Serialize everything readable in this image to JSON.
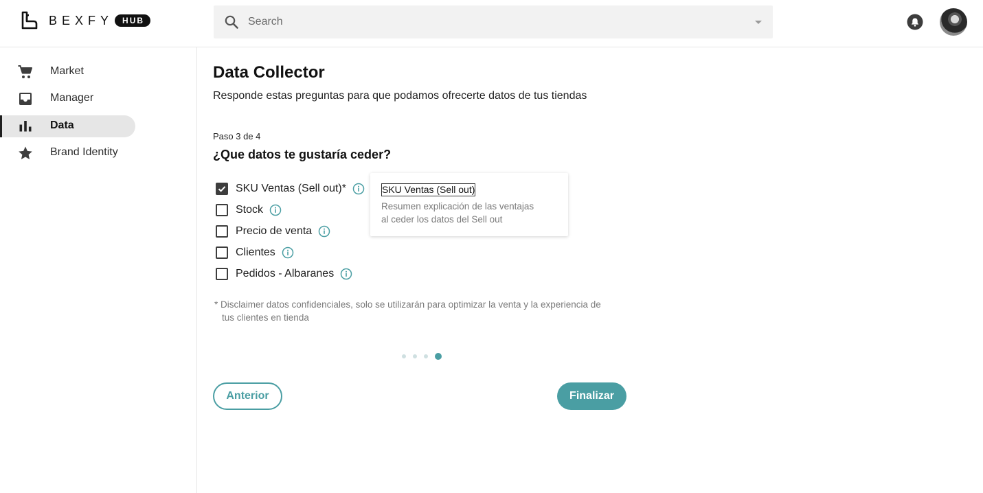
{
  "brand": {
    "name": "BEXFY",
    "badge": "HUB"
  },
  "search": {
    "placeholder": "Search"
  },
  "sidebar": {
    "items": [
      {
        "label": "Market",
        "icon": "cart-icon"
      },
      {
        "label": "Manager",
        "icon": "inbox-icon"
      },
      {
        "label": "Data",
        "icon": "bar-chart-icon",
        "active": true
      },
      {
        "label": "Brand Identity",
        "icon": "star-icon"
      }
    ]
  },
  "main": {
    "title": "Data Collector",
    "subtitle": "Responde estas preguntas para que podamos ofrecerte datos de tus tiendas",
    "step": "Paso 3 de 4",
    "question": "¿Que datos te gustaría ceder?",
    "options": [
      {
        "label": "SKU Ventas (Sell out)*",
        "checked": true
      },
      {
        "label": "Stock",
        "checked": false
      },
      {
        "label": "Precio de venta",
        "checked": false
      },
      {
        "label": "Clientes",
        "checked": false
      },
      {
        "label": "Pedidos - Albaranes",
        "checked": false
      }
    ],
    "tooltip": {
      "title": "SKU Ventas (Sell out)",
      "body_line1": "Resumen explicación de las ventajas",
      "body_line2": "al ceder los datos del Sell out"
    },
    "disclaimer_line1": "* Disclaimer datos confidenciales, solo se utilizarán para optimizar la venta y la experiencia de",
    "disclaimer_line2": "tus clientes en tienda",
    "pagination": {
      "total": 4,
      "current": 4
    },
    "buttons": {
      "prev": "Anterior",
      "next": "Finalizar"
    }
  },
  "colors": {
    "accent": "#4a9ea3",
    "active_bg": "#e6e6e6",
    "text": "#1f1f1f",
    "muted": "#7a7a7a"
  }
}
